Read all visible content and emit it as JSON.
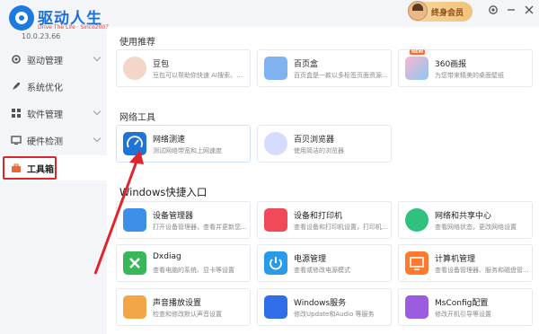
{
  "app": {
    "name": "驱动人生",
    "slogan": "Drive The Life · Since2007",
    "version": "10.0.23.66"
  },
  "header": {
    "vip_label": "终身会员",
    "settings_icon": "gear-icon",
    "minimize_icon": "minimize-icon",
    "close_icon": "close-icon"
  },
  "sidebar": {
    "items": [
      {
        "label": "驱动管理",
        "icon": "gear-icon"
      },
      {
        "label": "系统优化",
        "icon": "rocket-icon"
      },
      {
        "label": "软件管理",
        "icon": "grid-icon"
      },
      {
        "label": "硬件检测",
        "icon": "monitor-icon"
      },
      {
        "label": "工具箱",
        "icon": "toolbox-icon",
        "active": true
      }
    ]
  },
  "sections": {
    "recommend": {
      "title": "使用推荐"
    },
    "network": {
      "title": "网络工具"
    },
    "windows": {
      "title": "Windows快捷入口"
    }
  },
  "cards": {
    "doubao": {
      "title": "豆包",
      "desc": "豆包可以帮助你快速 AI搜索、单...",
      "color": "#f3d6c8"
    },
    "baiyehe": {
      "title": "百页盒",
      "desc": "百页盒是一款以多标签页面资源...",
      "color": "#7fb2ee"
    },
    "huabao": {
      "title": "360画报",
      "desc": "为您带来精美的桌面壁纸",
      "color": "#8ec7f2",
      "badge": "NEW"
    },
    "speedtest": {
      "title": "网络测速",
      "desc": "测试网络带宽和上网速度",
      "color": "#1f74d6"
    },
    "baibei": {
      "title": "百贝浏览器",
      "desc": "使用简洁的浏览器",
      "color": "#d6dcff"
    },
    "devmgr": {
      "title": "设备管理器",
      "desc": "打开设备管理器，查看并更新您...",
      "color": "#3d8fe8"
    },
    "printers": {
      "title": "设备和打印机",
      "desc": "查看设备和打印机设置，打印机及打印...",
      "color": "#f04a5a"
    },
    "netcenter": {
      "title": "网络和共享中心",
      "desc": "查看网络状态，更改网络设置",
      "color": "#2ec27e"
    },
    "dxdiag": {
      "title": "Dxdiag",
      "desc": "查看电脑的系统、显卡等设置",
      "color": "#39b55a"
    },
    "power": {
      "title": "电源管理",
      "desc": "查看或修改电源模式",
      "color": "#2a9be8"
    },
    "compmgmt": {
      "title": "计算机管理",
      "desc": "查看设备管理器、服务和磁盘管...",
      "color": "#ff7a2e"
    },
    "sound": {
      "title": "声音播放设置",
      "desc": "检查和修改默认声音设置",
      "color": "#f3a646"
    },
    "services": {
      "title": "Windows服务",
      "desc": "修改Update和Audio 等服务",
      "color": "#2f6ee6"
    },
    "msconfig": {
      "title": "MsConfig配置",
      "desc": "修改开机引导等设置",
      "color": "#9b5ce0"
    }
  },
  "colors": {
    "accent": "#1a6fd8",
    "highlight_box": "#e0242c",
    "arrow": "#e0242c"
  }
}
